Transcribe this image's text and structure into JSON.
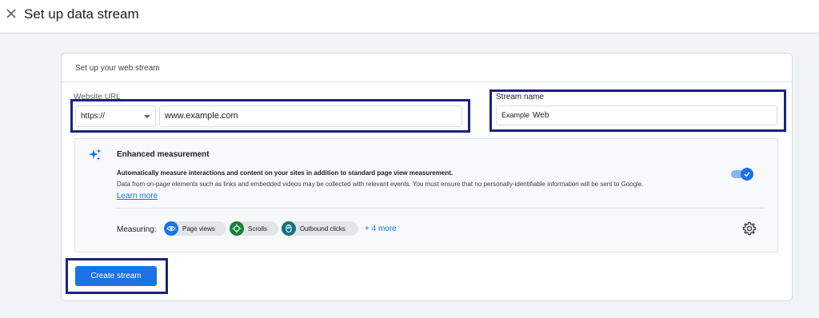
{
  "header": {
    "title": "Set up data stream",
    "close_icon": "close-icon"
  },
  "card": {
    "header_text": "Set up your web stream"
  },
  "website_url": {
    "label": "Website URL",
    "protocol_value": "https://",
    "url_value": "www.example.com"
  },
  "stream_name": {
    "label": "Stream name",
    "value_part1": "Example",
    "value_part2": "Web"
  },
  "enhanced_measurement": {
    "icon": "sparkle-icon",
    "title": "Enhanced measurement",
    "description_bold": "Automatically measure interactions and content on your sites in addition to standard page view measurement.",
    "description": "Data from on-page elements such as links and embedded videos may be collected with relevant events. You must ensure that no personally-identifiable information will be sent to Google.",
    "learn_more": "Learn more",
    "toggle_on": true,
    "measuring_label": "Measuring:",
    "chips": [
      {
        "label": "Page views",
        "icon": "eye-icon",
        "color": "#1a73e8"
      },
      {
        "label": "Scrolls",
        "icon": "crosshair-icon",
        "color": "#188038"
      },
      {
        "label": "Outbound clicks",
        "icon": "mouse-icon",
        "color": "#12727f"
      }
    ],
    "more_label": "+ 4 more",
    "settings_icon": "gear-icon"
  },
  "actions": {
    "create_label": "Create stream"
  },
  "colors": {
    "accent": "#1a73e8",
    "highlight_border": "#1a237e"
  }
}
